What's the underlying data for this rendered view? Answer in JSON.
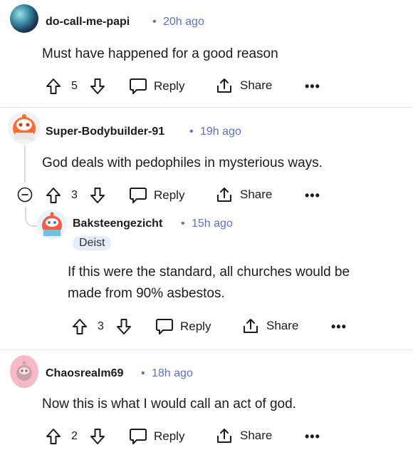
{
  "comments": [
    {
      "username": "do-call-me-papi",
      "time": "20h ago",
      "text": "Must have happened for a good reason",
      "votes": "5",
      "reply_label": "Reply",
      "share_label": "Share",
      "more_label": "•••"
    },
    {
      "username": "Super-Bodybuilder-91",
      "time": "19h ago",
      "text": "God deals with pedophiles in mysterious ways.",
      "votes": "3",
      "reply_label": "Reply",
      "share_label": "Share",
      "more_label": "•••"
    },
    {
      "username": "Baksteengezicht",
      "time": "15h ago",
      "flair": "Deist",
      "text_line1": "If this were the standard, all churches would be",
      "text_line2": "made from 90% asbestos.",
      "votes": "3",
      "reply_label": "Reply",
      "share_label": "Share",
      "more_label": "•••"
    },
    {
      "username": "Chaosrealm69",
      "time": "18h ago",
      "text": "Now this is what I would call an act of god.",
      "votes": "2",
      "reply_label": "Reply",
      "share_label": "Share",
      "more_label": "•••"
    }
  ],
  "time_separator": "•",
  "colors": {
    "time": "#5a6fd6",
    "flair_bg": "#e8ebf8",
    "thread_line": "#d5dbe0"
  }
}
